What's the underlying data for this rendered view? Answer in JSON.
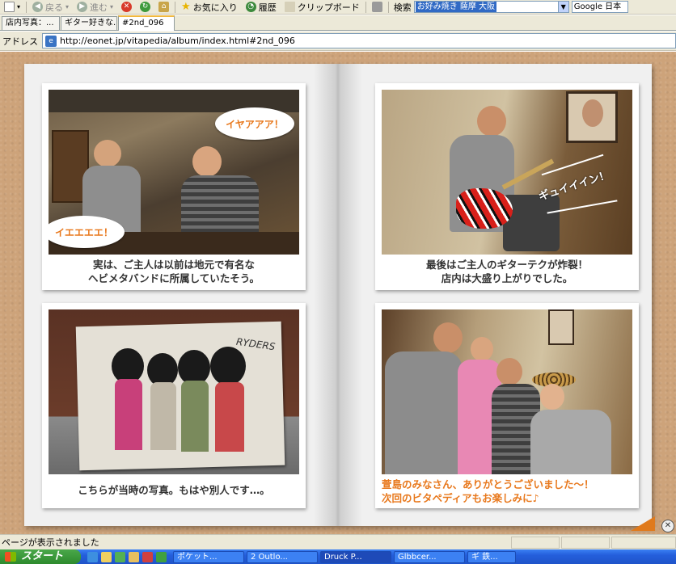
{
  "toolbar": {
    "back_label": "戻る",
    "forward_label": "進む",
    "favorites_label": "お気に入り",
    "history_label": "履歴",
    "clipboard_label": "クリップボード",
    "search_label": "検索",
    "search_value": "お好み焼き 薩摩 大阪",
    "google_label": "Google 日本"
  },
  "tabs": [
    {
      "label": "店内写真：..."
    },
    {
      "label": "ギター好きな..."
    },
    {
      "label": "#2nd_096"
    }
  ],
  "address": {
    "label": "アドレス",
    "url": "http://eonet.jp/vitapedia/album/index.html#2nd_096"
  },
  "album": {
    "photos": [
      {
        "caption_line1": "実は、ご主人は以前は地元で有名な",
        "caption_line2": "ヘビメタバンドに所属していたそう。",
        "bubble1": "イヤアアア！",
        "bubble2": "イエエエエ！"
      },
      {
        "caption_line1": "最後はご主人のギターテクが炸裂！",
        "caption_line2": "店内は大盛り上がりでした。",
        "sound_text": "ギュイイイン！"
      },
      {
        "caption_line1": "こちらが当時の写真。もはや別人です…。",
        "band_sign": "RYDERS"
      },
      {
        "caption_line1": "萱島のみなさん、ありがとうございました～！",
        "caption_line2": "次回のビタペディアもお楽しみに♪"
      }
    ]
  },
  "status": {
    "message": "ページが表示されました"
  },
  "taskbar": {
    "start_label": "スタート",
    "tasks": [
      {
        "label": "ポケット..."
      },
      {
        "label": "2 Outlo..."
      },
      {
        "label": "Druck P..."
      },
      {
        "label": "Glbbcer..."
      },
      {
        "label": "ギ 鉄..."
      }
    ]
  },
  "colors": {
    "caption_orange": "#e8781c",
    "background_cork": "#cda37a"
  }
}
